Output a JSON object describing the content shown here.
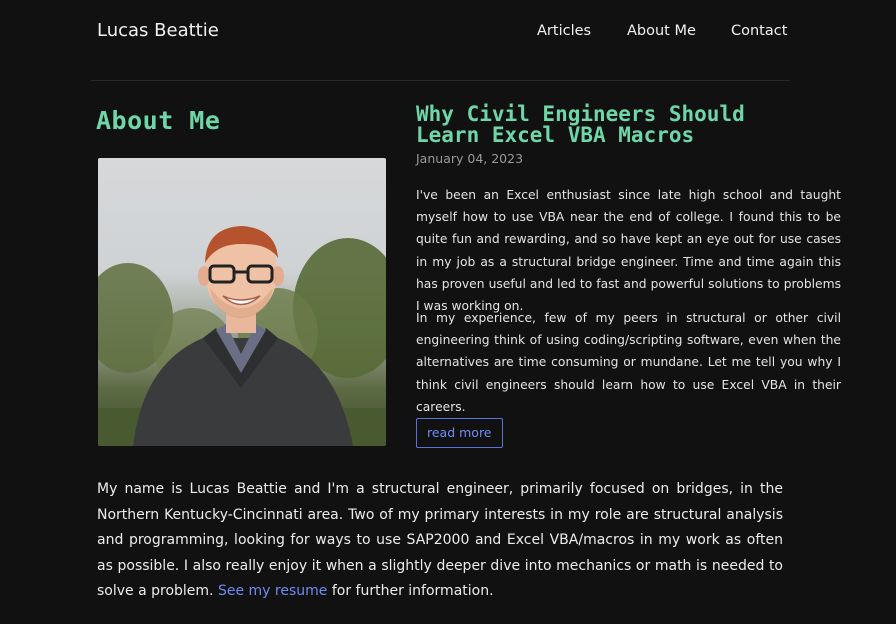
{
  "site": {
    "title": "Lucas Beattie"
  },
  "nav": {
    "articles": "Articles",
    "about": "About Me",
    "contact": "Contact"
  },
  "about": {
    "heading": "About Me",
    "bio_text": "My name is Lucas Beattie and I'm a structural engineer, primarily focused on bridges, in the Northern Kentucky-Cincinnati area. Two of my primary interests in my role are structural analysis and programming, looking for ways to use SAP2000 and Excel VBA/macros in my work as often as possible. I also really enjoy it when a slightly deeper dive into mechanics or math is needed to solve a problem.",
    "resume_link": "See my resume",
    "bio_tail": "for further information."
  },
  "post": {
    "title": "Why Civil Engineers Should Learn Excel VBA Macros",
    "date": "January 04, 2023",
    "p1": "I've been an Excel enthusiast since late high school and taught myself how to use VBA near the end of college. I found this to be quite fun and rewarding, and so have kept an eye out for use cases in my job as a structural bridge engineer. Time and time again this has proven useful and led to fast and powerful solutions to problems I was working on.",
    "p2": "In my experience, few of my peers in structural or other civil engineering think of using coding/scripting software, even when the alternatives are time consuming or mundane. Let me tell you why I think civil engineers should learn how to use Excel VBA in their careers.",
    "read_more": "read more"
  },
  "colors": {
    "background": "#111112",
    "accent": "#6fd6a8",
    "link": "#6f8bf0"
  }
}
